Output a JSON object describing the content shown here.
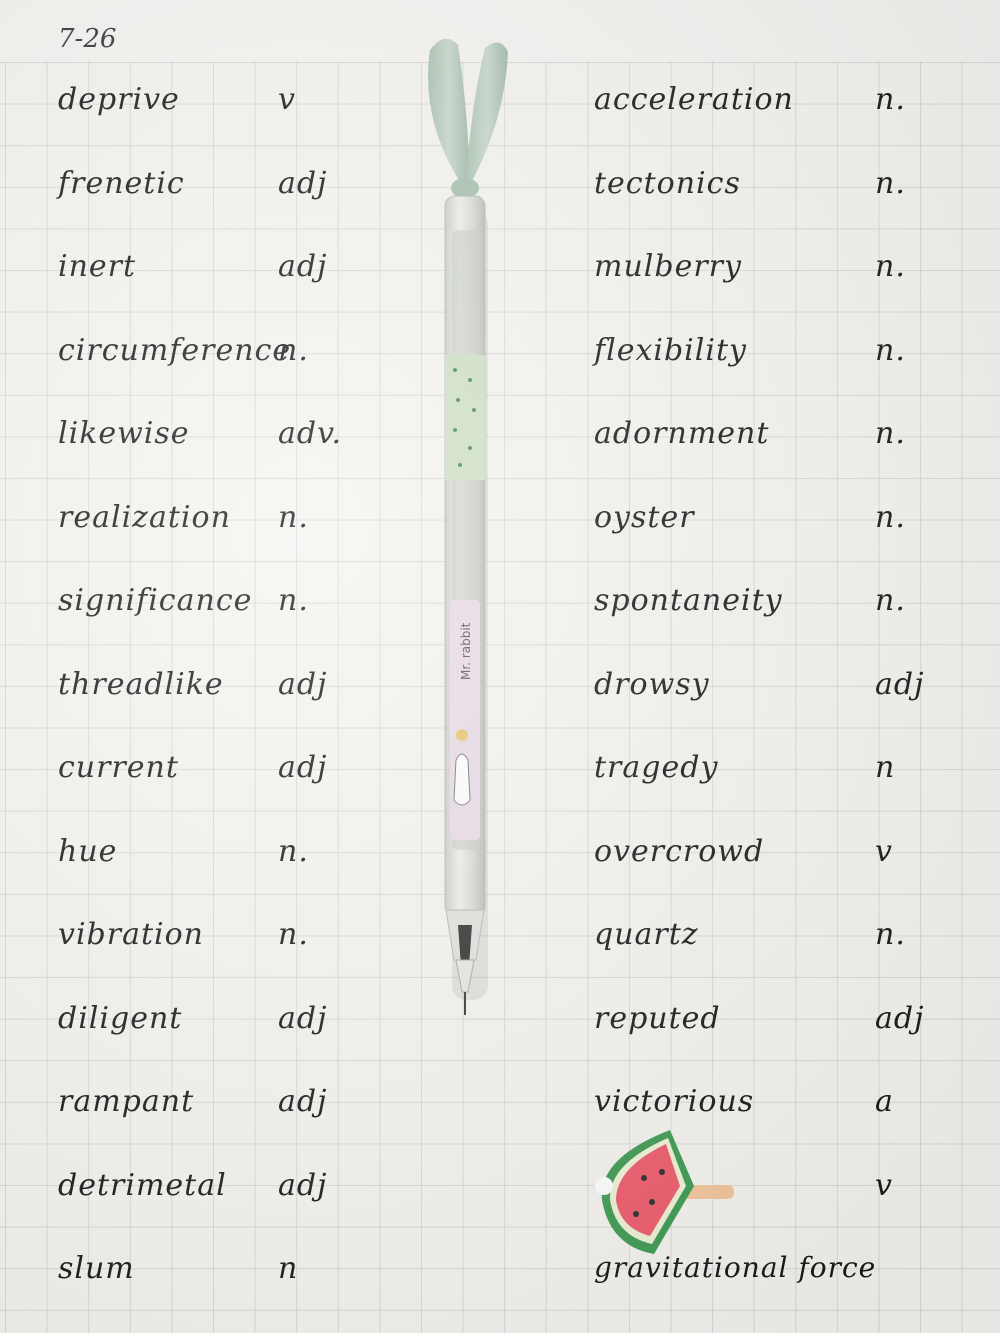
{
  "date": "7-26",
  "left_words": [
    {
      "word": "deprive",
      "pos": "v"
    },
    {
      "word": "frenetic",
      "pos": "adj"
    },
    {
      "word": "inert",
      "pos": "adj"
    },
    {
      "word": "circumference",
      "pos": "n."
    },
    {
      "word": "likewise",
      "pos": "adv."
    },
    {
      "word": "realization",
      "pos": "n."
    },
    {
      "word": "significance",
      "pos": "n."
    },
    {
      "word": "threadlike",
      "pos": "adj"
    },
    {
      "word": "current",
      "pos": "adj"
    },
    {
      "word": "hue",
      "pos": "n."
    },
    {
      "word": "vibration",
      "pos": "n."
    },
    {
      "word": "diligent",
      "pos": "adj"
    },
    {
      "word": "rampant",
      "pos": "adj"
    },
    {
      "word": "detrimetal",
      "pos": "adj"
    },
    {
      "word": "slum",
      "pos": "n"
    }
  ],
  "right_words": [
    {
      "word": "acceleration",
      "pos": "n."
    },
    {
      "word": "tectonics",
      "pos": "n."
    },
    {
      "word": "mulberry",
      "pos": "n."
    },
    {
      "word": "flexibility",
      "pos": "n."
    },
    {
      "word": "adornment",
      "pos": "n."
    },
    {
      "word": "oyster",
      "pos": "n."
    },
    {
      "word": "spontaneity",
      "pos": "n."
    },
    {
      "word": "drowsy",
      "pos": "adj"
    },
    {
      "word": "tragedy",
      "pos": "n"
    },
    {
      "word": "overcrowd",
      "pos": "v"
    },
    {
      "word": "quartz",
      "pos": "n."
    },
    {
      "word": "reputed",
      "pos": "adj"
    },
    {
      "word": "victorious",
      "pos": "a"
    },
    {
      "word": "",
      "pos": "v"
    },
    {
      "word": "gravitational  force",
      "pos": ""
    }
  ],
  "pen": {
    "label": "Mr. rabbit",
    "cap_color": "#b8cbbd",
    "barrel_color": "#dfe3dc"
  },
  "sticker": {
    "name": "watermelon-popsicle-icon"
  }
}
